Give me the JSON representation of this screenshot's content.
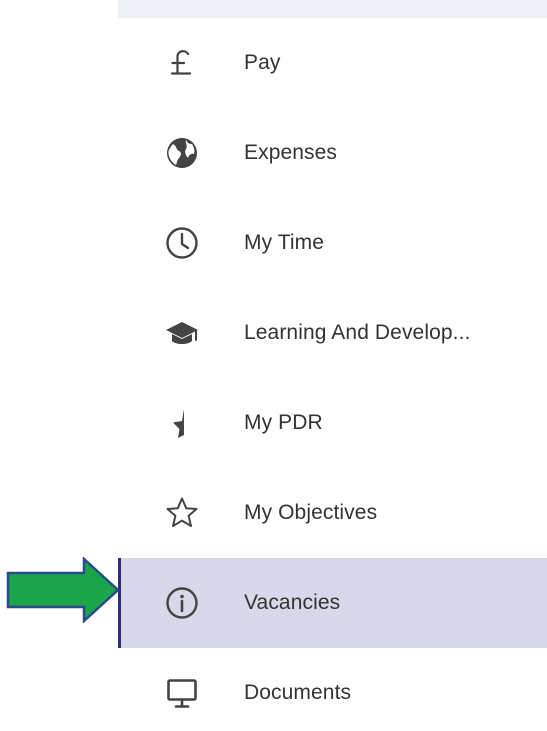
{
  "nav": {
    "items": [
      {
        "label": "Pay",
        "icon": "pound-sterling-icon"
      },
      {
        "label": "Expenses",
        "icon": "globe-icon"
      },
      {
        "label": "My Time",
        "icon": "clock-icon"
      },
      {
        "label": "Learning And Develop...",
        "icon": "graduation-cap-icon"
      },
      {
        "label": "My PDR",
        "icon": "half-star-icon"
      },
      {
        "label": "My Objectives",
        "icon": "star-outline-icon"
      },
      {
        "label": "Vacancies",
        "icon": "info-icon",
        "active": true
      },
      {
        "label": "Documents",
        "icon": "monitor-icon"
      }
    ]
  },
  "colors": {
    "active_bg": "#d7d8ea",
    "active_border": "#2b2f7a",
    "arrow_fill": "#1aa54a",
    "arrow_stroke": "#2a4a8c",
    "icon": "#444444",
    "text": "#333333"
  }
}
